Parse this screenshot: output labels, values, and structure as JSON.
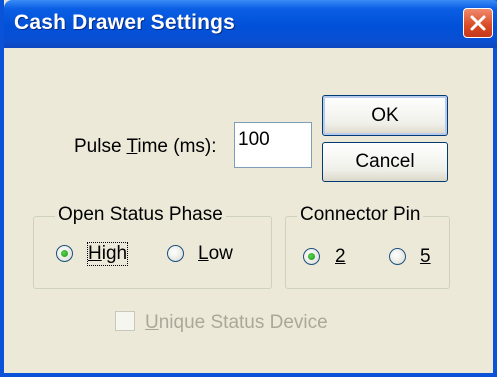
{
  "window": {
    "title": "Cash Drawer Settings"
  },
  "pulse_time": {
    "label_prefix": "Pulse ",
    "label_accel": "T",
    "label_suffix": "ime (ms):",
    "value": "100"
  },
  "buttons": {
    "ok": "OK",
    "cancel": "Cancel"
  },
  "open_status_phase": {
    "title": "Open Status Phase",
    "options": [
      {
        "accel": "H",
        "rest": "igh",
        "checked": true
      },
      {
        "accel": "L",
        "rest": "ow",
        "checked": false
      }
    ]
  },
  "connector_pin": {
    "title": "Connector Pin",
    "options": [
      {
        "accel": "2",
        "rest": "",
        "checked": true
      },
      {
        "accel": "5",
        "rest": "",
        "checked": false
      }
    ]
  },
  "unique_status": {
    "accel": "U",
    "rest": "nique Status Device",
    "checked": false,
    "enabled": false
  },
  "colors": {
    "titlebar": "#0050D8",
    "background": "#ECE9D8",
    "close_button": "#D94A24",
    "radio_dot": "#21A121"
  }
}
